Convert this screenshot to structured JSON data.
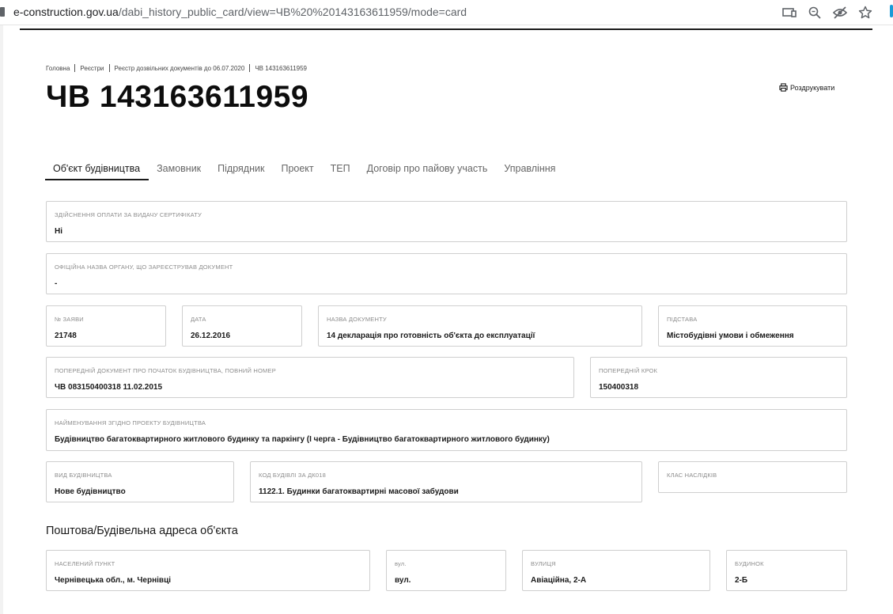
{
  "browser": {
    "url_host": "e-construction.gov.ua",
    "url_path": "/dabi_history_public_card/view=ЧВ%20%20143163611959/mode=card",
    "icons": [
      "cast-icon",
      "zoom-icon",
      "eye-off-icon",
      "star-icon"
    ]
  },
  "breadcrumb": [
    "Головна",
    "Реєстри",
    "Реєстр дозвільних документів до 06.07.2020",
    "ЧВ 143163611959"
  ],
  "title": "ЧВ 143163611959",
  "print_label": "Роздрукувати",
  "tabs": [
    "Об'єкт будівництва",
    "Замовник",
    "Підрядник",
    "Проект",
    "ТЕП",
    "Договір про пайову участь",
    "Управління"
  ],
  "active_tab": 0,
  "fields": {
    "payment": {
      "label": "Здійснення оплати за видачу сертифікату",
      "value": "Ні"
    },
    "authority": {
      "label": "Офіційна назва органу, що зареєстрував документ",
      "value": "-"
    },
    "app_no": {
      "label": "№ заяви",
      "value": "21748"
    },
    "date": {
      "label": "Дата",
      "value": "26.12.2016"
    },
    "doc_name": {
      "label": "Назва документу",
      "value": "14 декларація про готовність об'єкта до експлуатації"
    },
    "basis": {
      "label": "Підстава",
      "value": "Містобудівні умови і обмеження"
    },
    "prev_doc": {
      "label": "Попередній документ про початок будівництва, повний номер",
      "value": "ЧВ 083150400318 11.02.2015"
    },
    "prev_step": {
      "label": "Попередній крок",
      "value": "150400318"
    },
    "project_name": {
      "label": "Найменування згідно проекту будівництва",
      "value": "Будівництво багатоквартирного житлового будинку та паркінгу (І черга - Будівництво багатоквартирного житлового будинку)"
    },
    "build_type": {
      "label": "Вид будівництва",
      "value": "Нове будівництво"
    },
    "building_code": {
      "label": "Код будівлі за ДК018",
      "value": "1122.1. Будинки багатоквартирні масової забудови"
    },
    "consequence_class": {
      "label": "Клас наслідків",
      "value": ""
    }
  },
  "address_title": "Поштова/Будівельна адреса об'єкта",
  "address": {
    "locality": {
      "label": "Населений пункт",
      "value": "Чернівецька обл., м. Чернівці"
    },
    "street_type": {
      "label": "вул.",
      "value": "вул."
    },
    "street": {
      "label": "Вулиця",
      "value": "Авіаційна, 2-А"
    },
    "house": {
      "label": "Будинок",
      "value": "2-Б"
    }
  }
}
